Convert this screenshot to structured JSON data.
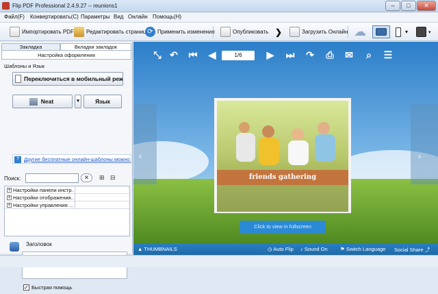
{
  "window": {
    "title": "Flip PDF Professional 2.4.9.27 -- reunions1"
  },
  "menu": [
    "Файл(F)",
    "Конвертировать(C)",
    "Параметры",
    "Вид",
    "Онлайн",
    "Помощь(H)"
  ],
  "toolbar": {
    "import_pdf": "Импортировать PDF(I)",
    "edit_pages": "Редактировать страницы",
    "apply_changes": "Применить изменения",
    "publish": "Опубликовать",
    "upload_online": "Загрузить Онлайн"
  },
  "left": {
    "tabs": [
      "Закладка",
      "Вкладки закладок"
    ],
    "subtab": "Настройка оформления",
    "templates_label": "Шаблоны и Язык",
    "switch_mobile": "Переключиться в мобильный реж",
    "theme_button": "Neat",
    "language_button": "Язык",
    "more_templates_link": "Другие бесплатные онлайн-шаблоны можно н",
    "search_label": "Поиск:",
    "search_value": "",
    "tree_items": [
      "Настройки панели инстр...",
      "Настройки отображения...",
      "Настройки управления ..."
    ],
    "help_title": "Заголовок",
    "quick_help_label": "Быстрая помощь",
    "quick_help_checked": true
  },
  "viewer": {
    "page_indicator": "1/6",
    "book_caption": "friends gathering",
    "fullscreen_label": "Click to view in fullscreen",
    "bottom": {
      "thumbnails": "THUMBNAILS",
      "auto_flip": "Auto Flip",
      "sound": "Sound On",
      "switch_language": "Switch Language",
      "social_share": "Social Share"
    }
  },
  "colors": {
    "accent": "#2b7fc4",
    "sky": "#4a9fe0",
    "grass": "#6fa832",
    "caption_band": "#c96a3a"
  }
}
